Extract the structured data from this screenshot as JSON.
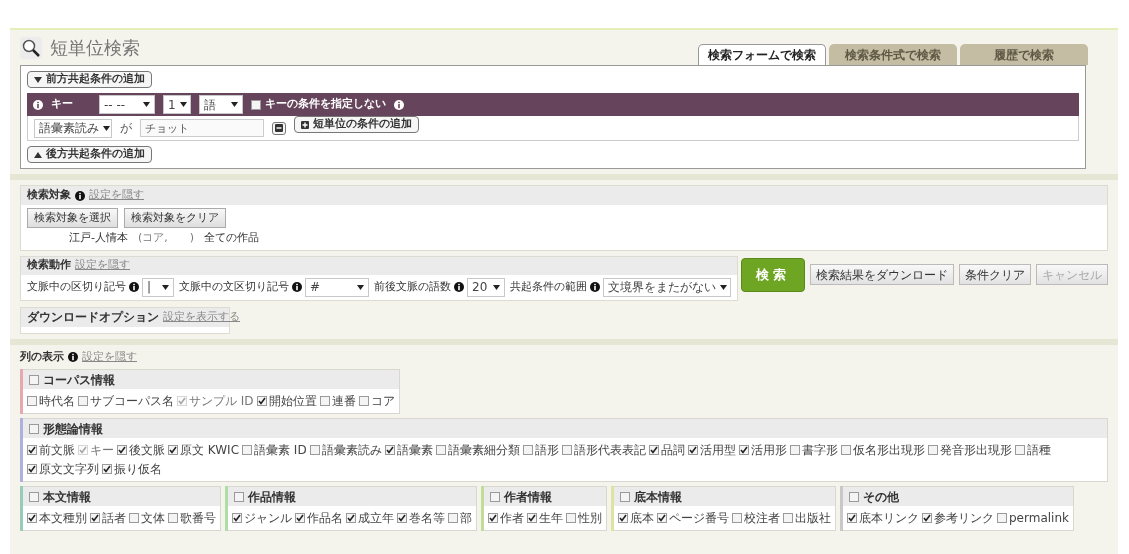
{
  "title": "短単位検索",
  "tabs": [
    {
      "label": "検索フォームで検索",
      "selected": true
    },
    {
      "label": "検索条件式で検索",
      "selected": false
    },
    {
      "label": "履歴で検索",
      "selected": false
    }
  ],
  "form": {
    "add_before": "前方共起条件の追加",
    "key_row": {
      "label": "キー",
      "selects": [
        "-- --",
        "1",
        "語"
      ],
      "no_condition": {
        "label": "キーの条件を指定しない",
        "checked": false
      }
    },
    "condition": {
      "field": "語彙素読み",
      "particle": "が",
      "value": "チョット",
      "add_unit": "短単位の条件の追加"
    },
    "add_after": "後方共起条件の追加"
  },
  "target": {
    "title": "検索対象",
    "toggle": "設定を隠す",
    "buttons": [
      "検索対象を選択",
      "検索対象をクリア"
    ],
    "summary": [
      "江戸-人情本",
      "(コア,　　)",
      "全ての作品"
    ]
  },
  "behavior": {
    "title": "検索動作",
    "toggle": "設定を隠す",
    "fields": [
      {
        "label": "文脈中の区切り記号",
        "value": "|"
      },
      {
        "label": "文脈中の文区切り記号",
        "value": "#"
      },
      {
        "label": "前後文脈の語数",
        "value": "20"
      },
      {
        "label": "共起条件の範囲",
        "value": "文境界をまたがない"
      }
    ]
  },
  "actions": [
    {
      "label": "検索",
      "kind": "primary",
      "disabled": false
    },
    {
      "label": "検索結果をダウンロード",
      "kind": "normal",
      "disabled": false
    },
    {
      "label": "条件クリア",
      "kind": "normal",
      "disabled": false
    },
    {
      "label": "キャンセル",
      "kind": "normal",
      "disabled": true
    }
  ],
  "download_options": {
    "title": "ダウンロードオプション",
    "toggle": "設定を表示する"
  },
  "columns": {
    "title": "列の表示",
    "toggle": "設定を隠す",
    "group_rows": [
      [
        {
          "title": "コーパス情報",
          "checked": false,
          "color": "#e8a8b0",
          "items": [
            {
              "label": "時代名",
              "checked": false,
              "disabled": false
            },
            {
              "label": "サブコーパス名",
              "checked": false,
              "disabled": false
            },
            {
              "label": "サンプル ID",
              "checked": true,
              "disabled": true
            },
            {
              "label": "開始位置",
              "checked": true,
              "disabled": false
            },
            {
              "label": "連番",
              "checked": false,
              "disabled": false
            },
            {
              "label": "コア",
              "checked": false,
              "disabled": false
            }
          ]
        }
      ],
      [
        {
          "title": "形態論情報",
          "checked": false,
          "color": "#b0b0dc",
          "items": [
            {
              "label": "前文脈",
              "checked": true,
              "disabled": false
            },
            {
              "label": "キー",
              "checked": true,
              "disabled": true
            },
            {
              "label": "後文脈",
              "checked": true,
              "disabled": false
            },
            {
              "label": "原文 KWIC",
              "checked": true,
              "disabled": false
            },
            {
              "label": "語彙素 ID",
              "checked": false,
              "disabled": false
            },
            {
              "label": "語彙素読み",
              "checked": false,
              "disabled": false
            },
            {
              "label": "語彙素",
              "checked": true,
              "disabled": false
            },
            {
              "label": "語彙素細分類",
              "checked": false,
              "disabled": false
            },
            {
              "label": "語形",
              "checked": false,
              "disabled": false
            },
            {
              "label": "語形代表表記",
              "checked": false,
              "disabled": false
            },
            {
              "label": "品詞",
              "checked": true,
              "disabled": false
            },
            {
              "label": "活用型",
              "checked": true,
              "disabled": false
            },
            {
              "label": "活用形",
              "checked": true,
              "disabled": false
            },
            {
              "label": "書字形",
              "checked": false,
              "disabled": false
            },
            {
              "label": "仮名形出現形",
              "checked": false,
              "disabled": false
            },
            {
              "label": "発音形出現形",
              "checked": false,
              "disabled": false
            },
            {
              "label": "語種",
              "checked": false,
              "disabled": false
            },
            {
              "label": "原文文字列",
              "checked": true,
              "disabled": false
            },
            {
              "label": "振り仮名",
              "checked": true,
              "disabled": false
            }
          ]
        }
      ],
      [
        {
          "title": "本文情報",
          "checked": false,
          "color": "#98ccb4",
          "items": [
            {
              "label": "本文種別",
              "checked": true,
              "disabled": false
            },
            {
              "label": "話者",
              "checked": true,
              "disabled": false
            },
            {
              "label": "文体",
              "checked": false,
              "disabled": false
            },
            {
              "label": "歌番号",
              "checked": false,
              "disabled": false
            }
          ]
        },
        {
          "title": "作品情報",
          "checked": false,
          "color": "#b0dca8",
          "items": [
            {
              "label": "ジャンル",
              "checked": true,
              "disabled": false
            },
            {
              "label": "作品名",
              "checked": true,
              "disabled": false
            },
            {
              "label": "成立年",
              "checked": true,
              "disabled": false
            },
            {
              "label": "巻名等",
              "checked": true,
              "disabled": false
            },
            {
              "label": "部",
              "checked": false,
              "disabled": false
            }
          ]
        },
        {
          "title": "作者情報",
          "checked": false,
          "color": "#c4dc98",
          "items": [
            {
              "label": "作者",
              "checked": true,
              "disabled": false
            },
            {
              "label": "生年",
              "checked": true,
              "disabled": false
            },
            {
              "label": "性別",
              "checked": false,
              "disabled": false
            }
          ]
        },
        {
          "title": "底本情報",
          "checked": false,
          "color": "#dce4a0",
          "items": [
            {
              "label": "底本",
              "checked": true,
              "disabled": false
            },
            {
              "label": "ページ番号",
              "checked": true,
              "disabled": false
            },
            {
              "label": "校注者",
              "checked": false,
              "disabled": false
            },
            {
              "label": "出版社",
              "checked": false,
              "disabled": false
            }
          ]
        },
        {
          "title": "その他",
          "checked": false,
          "color": "#c8c8c8",
          "items": [
            {
              "label": "底本リンク",
              "checked": true,
              "disabled": false
            },
            {
              "label": "参考リンク",
              "checked": true,
              "disabled": false
            },
            {
              "label": "permalink",
              "checked": false,
              "disabled": false
            }
          ]
        }
      ]
    ]
  }
}
